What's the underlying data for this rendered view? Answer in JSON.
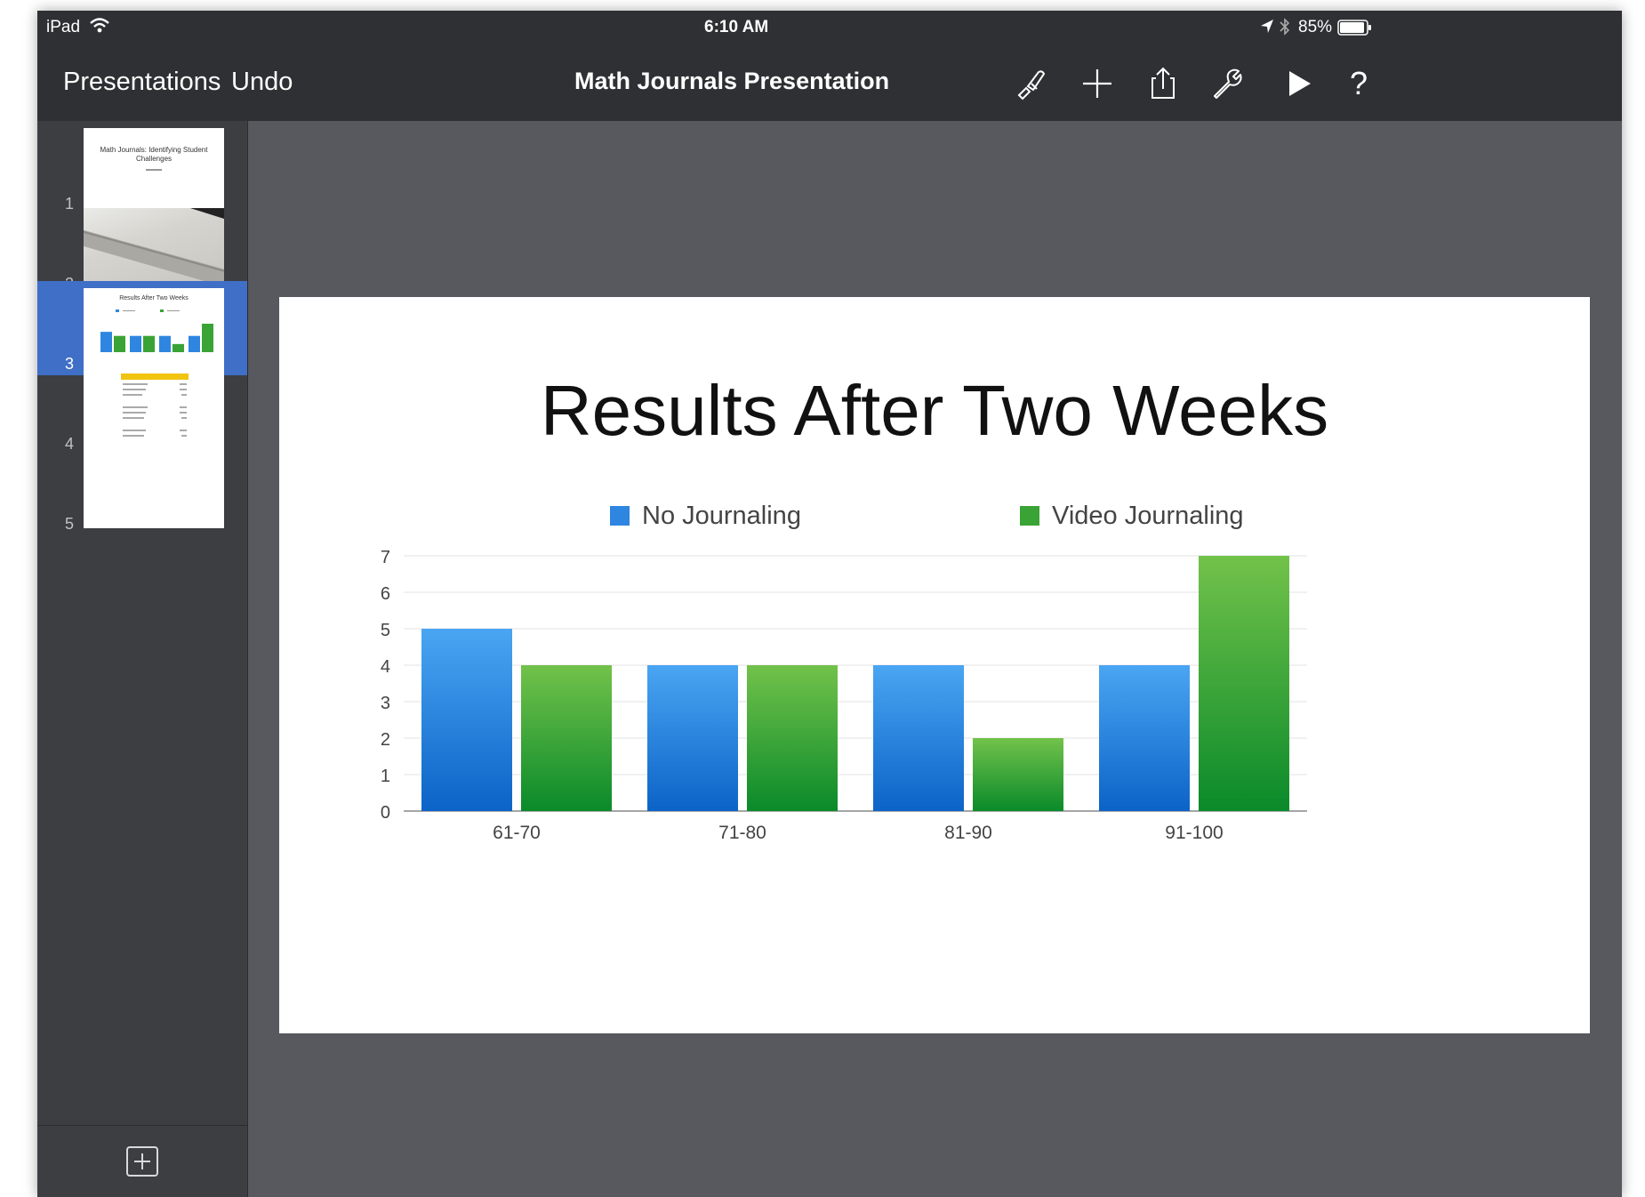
{
  "status_bar": {
    "device": "iPad",
    "time": "6:10 AM",
    "battery": "85%"
  },
  "nav": {
    "back_label": "Presentations",
    "undo_label": "Undo",
    "title": "Math Journals Presentation",
    "icons": [
      "paintbrush-icon",
      "plus-icon",
      "share-icon",
      "wrench-icon",
      "play-icon",
      "help-icon"
    ],
    "help_glyph": "?"
  },
  "slides": [
    {
      "number": "1",
      "kind": "title",
      "text": "Math Journals: Identifying Student Challenges"
    },
    {
      "number": "2",
      "kind": "photo",
      "text": ""
    },
    {
      "number": "3",
      "kind": "chart",
      "text": "Results After Two Weeks",
      "selected": true
    },
    {
      "number": "4",
      "kind": "table",
      "text": ""
    },
    {
      "number": "5",
      "kind": "blank",
      "text": ""
    }
  ],
  "slide": {
    "title": "Results After Two Weeks"
  },
  "chart_data": {
    "type": "bar",
    "categories": [
      "61-70",
      "71-80",
      "81-90",
      "91-100"
    ],
    "series": [
      {
        "name": "No Journaling",
        "values": [
          5,
          4,
          4,
          4
        ],
        "color": "#2f86e0"
      },
      {
        "name": "Video Journaling",
        "values": [
          4,
          4,
          2,
          7
        ],
        "color": "#3aa336"
      }
    ],
    "yticks": [
      "0",
      "1",
      "2",
      "3",
      "4",
      "5",
      "6",
      "7"
    ],
    "ylim": [
      0,
      7
    ],
    "grid": true,
    "legend": "top-center",
    "xlabel": "",
    "ylabel": ""
  },
  "colors": {
    "toolbar": "#2f3033",
    "sidebar": "#3c3e42",
    "canvas": "#58595e",
    "selection": "#3f6fc6"
  }
}
